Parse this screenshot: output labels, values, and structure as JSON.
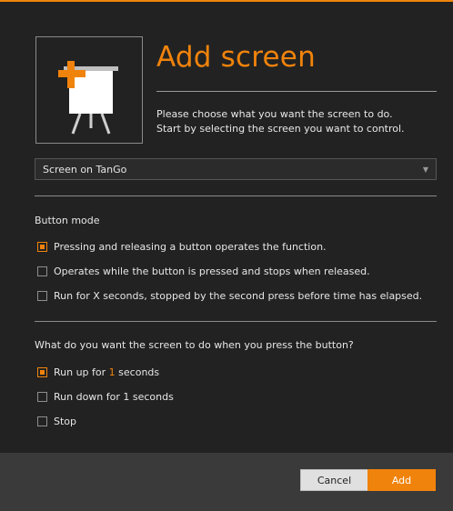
{
  "header": {
    "title": "Add screen",
    "description_line1": "Please choose what you want the screen to do.",
    "description_line2": "Start by selecting the screen you want to control."
  },
  "icon": {
    "name": "screen-easel-add-icon"
  },
  "screen_select": {
    "value": "Screen on TanGo"
  },
  "button_mode": {
    "label": "Button mode",
    "options": [
      {
        "label": "Pressing and releasing a button operates the function.",
        "checked": true
      },
      {
        "label": "Operates while the button is pressed and stops when released.",
        "checked": false
      },
      {
        "label": "Run for X seconds, stopped by the second press before time has elapsed.",
        "checked": false
      }
    ]
  },
  "action": {
    "label": "What do you want the screen to do when you press the button?",
    "options": [
      {
        "prefix": "Run up for ",
        "value": "1",
        "suffix": " seconds",
        "checked": true
      },
      {
        "label": "Run down for 1 seconds",
        "checked": false
      },
      {
        "label": "Stop",
        "checked": false
      }
    ]
  },
  "footer": {
    "cancel_label": "Cancel",
    "add_label": "Add"
  },
  "colors": {
    "accent": "#f0830c",
    "background": "#222222",
    "footer": "#3a3a3a"
  }
}
